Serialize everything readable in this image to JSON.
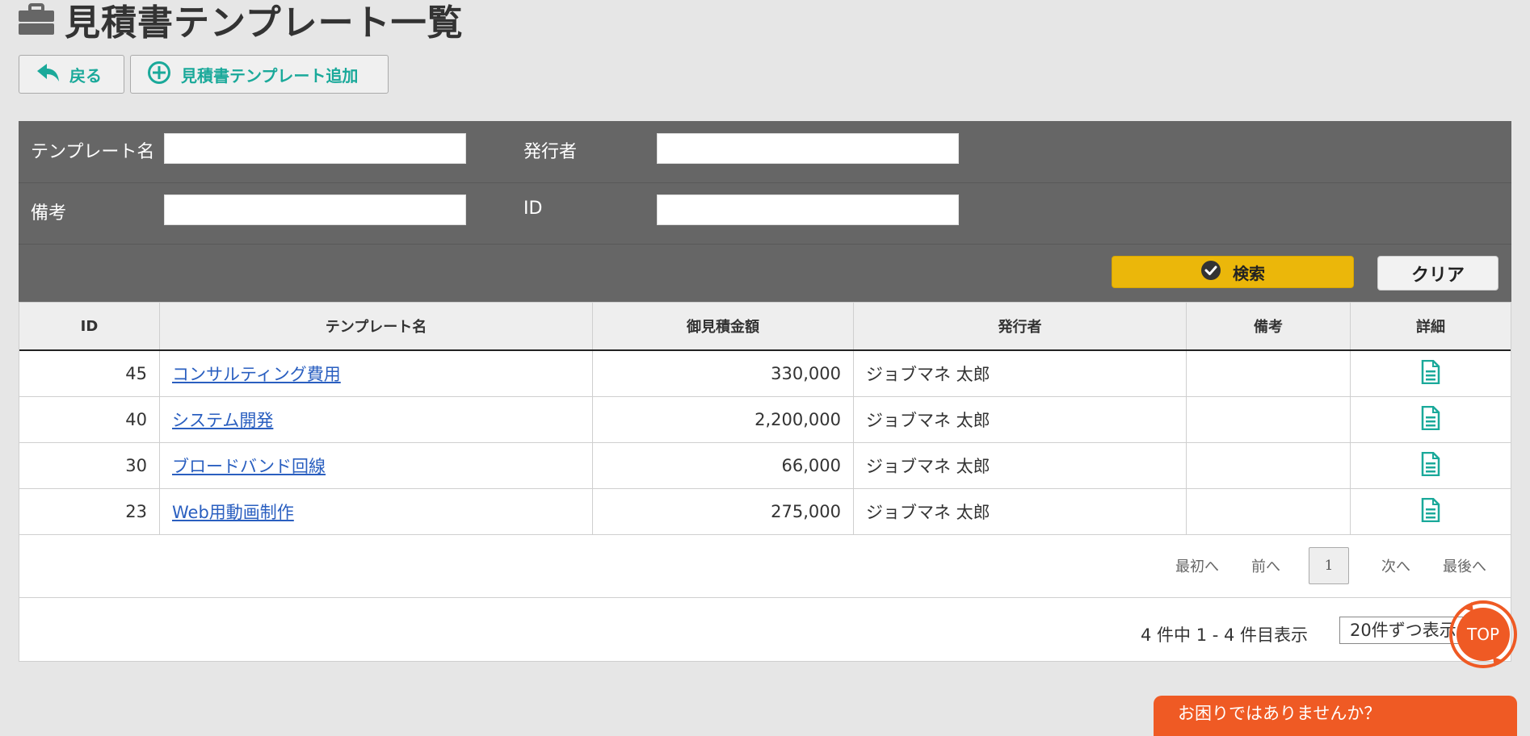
{
  "header": {
    "title": "見積書テンプレート一覧",
    "title_icon": "briefcase-icon"
  },
  "toolbar": {
    "back_label": "戻る",
    "back_icon": "reply-arrow-icon",
    "add_label": "見積書テンプレート追加",
    "add_icon": "plus-circle-icon",
    "accent_color": "#1aa99a"
  },
  "search": {
    "template_name_label": "テンプレート名",
    "template_name_value": "",
    "issuer_label": "発行者",
    "issuer_value": "",
    "remarks_label": "備考",
    "remarks_value": "",
    "id_label": "ID",
    "id_value": "",
    "search_label": "検索",
    "clear_label": "クリア",
    "search_color": "#ebb70a"
  },
  "table": {
    "headers": [
      "ID",
      "テンプレート名",
      "御見積金額",
      "発行者",
      "備考",
      "詳細"
    ],
    "rows": [
      {
        "id": "45",
        "name": "コンサルティング費用",
        "amount": "330,000",
        "issuer": "ジョブマネ 太郎",
        "remarks": ""
      },
      {
        "id": "40",
        "name": "システム開発",
        "amount": "2,200,000",
        "issuer": "ジョブマネ 太郎",
        "remarks": ""
      },
      {
        "id": "30",
        "name": "ブロードバンド回線",
        "amount": "66,000",
        "issuer": "ジョブマネ 太郎",
        "remarks": ""
      },
      {
        "id": "23",
        "name": "Web用動画制作",
        "amount": "275,000",
        "issuer": "ジョブマネ 太郎",
        "remarks": ""
      }
    ],
    "detail_icon": "document-icon"
  },
  "pager": {
    "first": "最初へ",
    "prev": "前へ",
    "current": "1",
    "next": "次へ",
    "last": "最後へ"
  },
  "summary": {
    "text": "4 件中 1 - 4 件目表示",
    "per_page": "20件ずつ表示"
  },
  "floating": {
    "top_label": "TOP",
    "help_label": "お困りではありませんか？",
    "help_color": "#ef5a24"
  }
}
